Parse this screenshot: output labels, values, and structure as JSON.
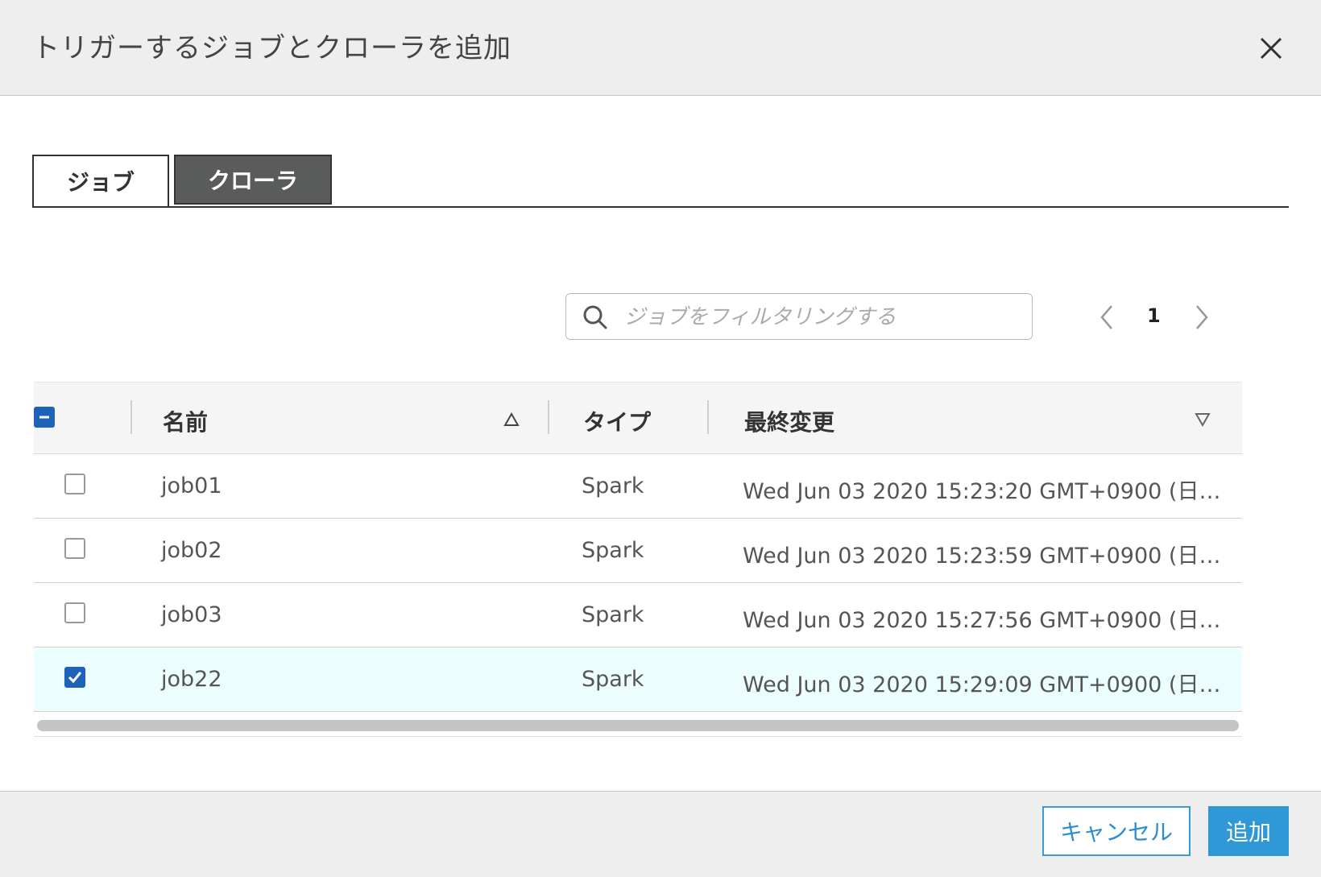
{
  "dialog": {
    "title": "トリガーするジョブとクローラを追加"
  },
  "tabs": [
    {
      "label": "ジョブ",
      "active": true
    },
    {
      "label": "クローラ",
      "active": false
    }
  ],
  "search": {
    "placeholder": "ジョブをフィルタリングする",
    "icon": "search-icon"
  },
  "pagination": {
    "current_page": "1"
  },
  "table": {
    "columns": [
      "名前",
      "タイプ",
      "最終変更"
    ],
    "rows": [
      {
        "name": "job01",
        "type": "Spark",
        "modified": "Wed Jun 03 2020 15:23:20 GMT+0900 (日…",
        "checked": false
      },
      {
        "name": "job02",
        "type": "Spark",
        "modified": "Wed Jun 03 2020 15:23:59 GMT+0900 (日…",
        "checked": false
      },
      {
        "name": "job03",
        "type": "Spark",
        "modified": "Wed Jun 03 2020 15:27:56 GMT+0900 (日…",
        "checked": false
      },
      {
        "name": "job22",
        "type": "Spark",
        "modified": "Wed Jun 03 2020 15:29:09 GMT+0900 (日…",
        "checked": true
      }
    ]
  },
  "footer": {
    "cancel_label": "キャンセル",
    "add_label": "追加"
  },
  "colors": {
    "accent": "#2f98d6",
    "checkbox_checked": "#1f62b9",
    "selected_row": "#ecfdfd"
  }
}
